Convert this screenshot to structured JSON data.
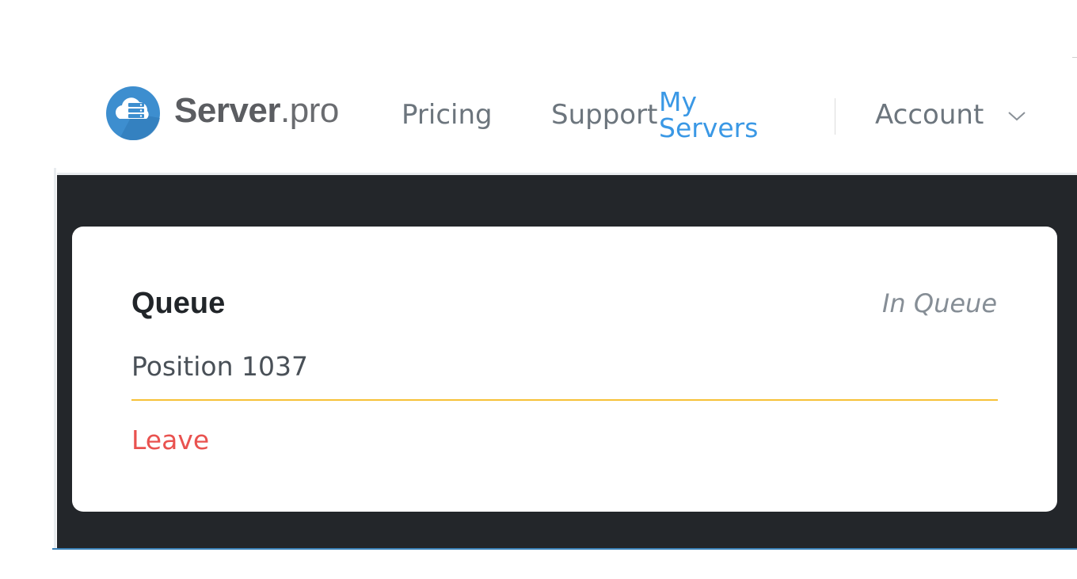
{
  "header": {
    "logo": {
      "brand_strong": "Server",
      "brand_light": ".pro",
      "icon": "cloud-server-icon"
    },
    "nav": {
      "pricing": "Pricing",
      "support": "Support",
      "my_servers": "My Servers",
      "account": "Account",
      "account_icon": "chevron-down-icon"
    }
  },
  "queue_card": {
    "title": "Queue",
    "status": "In Queue",
    "position": "Position 1037",
    "leave_label": "Leave"
  },
  "colors": {
    "accent_blue": "#3a98e5",
    "dark_panel": "#23262a",
    "queue_line": "#f7c138",
    "leave_red": "#e9524f"
  }
}
